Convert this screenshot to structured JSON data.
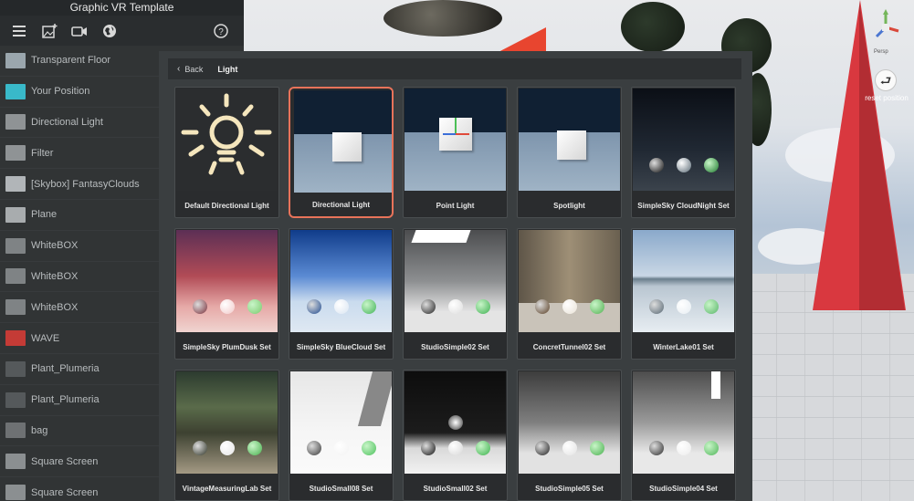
{
  "app": {
    "title": "Graphic VR Template"
  },
  "toolbar": {
    "icons": [
      "menu-icon",
      "add-image-icon",
      "video-icon",
      "globe-icon",
      "help-icon"
    ]
  },
  "scene": {
    "reset_label": "reset position",
    "gizmo_label": "Persp"
  },
  "sidebar": {
    "items": [
      {
        "label": "Transparent Floor",
        "thumb": "#9aa6ad"
      },
      {
        "label": "Your Position",
        "thumb": "#39b9c9"
      },
      {
        "label": "Directional Light",
        "thumb": "#8f9395"
      },
      {
        "label": "Filter",
        "thumb": "#8f9395"
      },
      {
        "label": "[Skybox] FantasyClouds",
        "thumb": "#b1b5b8"
      },
      {
        "label": "Plane",
        "thumb": "#a8acae"
      },
      {
        "label": "WhiteBOX",
        "thumb": "#7f8385"
      },
      {
        "label": "WhiteBOX",
        "thumb": "#7f8385"
      },
      {
        "label": "WhiteBOX",
        "thumb": "#7f8385"
      },
      {
        "label": "WAVE",
        "thumb": "#c43b36"
      },
      {
        "label": "Plant_Plumeria",
        "thumb": "#55595b"
      },
      {
        "label": "Plant_Plumeria",
        "thumb": "#55595b"
      },
      {
        "label": "bag",
        "thumb": "#6e7173"
      },
      {
        "label": "Square Screen",
        "thumb": "#8b8f91"
      },
      {
        "label": "Square Screen",
        "thumb": "#8b8f91"
      }
    ]
  },
  "panel": {
    "back_label": "Back",
    "breadcrumb": "Light",
    "cards": [
      {
        "label": "Default Directional Light",
        "kind": "bulb"
      },
      {
        "label": "Directional Light",
        "kind": "cube",
        "selected": true
      },
      {
        "label": "Point Light",
        "kind": "gizmo-cube"
      },
      {
        "label": "Spotlight",
        "kind": "cube"
      },
      {
        "label": "SimpleSky CloudNight Set",
        "kind": "night"
      },
      {
        "label": "SimpleSky PlumDusk Set",
        "kind": "dusk"
      },
      {
        "label": "SimpleSky BlueCloud Set",
        "kind": "bluecloud"
      },
      {
        "label": "StudioSimple02 Set",
        "kind": "studio"
      },
      {
        "label": "ConcretTunnel02 Set",
        "kind": "tunnel"
      },
      {
        "label": "WinterLake01 Set",
        "kind": "lake"
      },
      {
        "label": "VintageMeasuringLab Set",
        "kind": "lab"
      },
      {
        "label": "StudioSmall08 Set",
        "kind": "white"
      },
      {
        "label": "StudioSmall02 Set",
        "kind": "dark"
      },
      {
        "label": "StudioSimple05 Set",
        "kind": "gray"
      },
      {
        "label": "StudioSimple04 Set",
        "kind": "gray2"
      }
    ]
  }
}
